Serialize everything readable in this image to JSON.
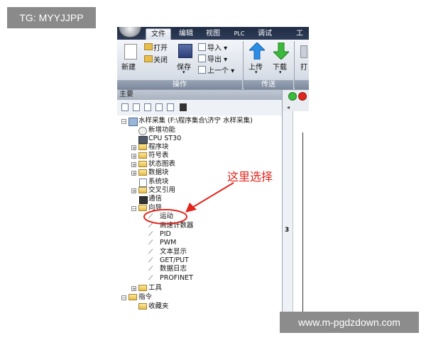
{
  "overlay": {
    "tag": "TG: MYYJJPP",
    "watermark": "www.m-pgdzdown.com",
    "annotation": "这里选择"
  },
  "ribbon": {
    "tabs": [
      "文件",
      "编辑",
      "视图",
      "PLC",
      "调试",
      "工"
    ],
    "groups": {
      "operate": {
        "label": "操作",
        "new": "新建",
        "open": "打开",
        "close": "关闭",
        "save": "保存",
        "import": "导入",
        "export": "导出",
        "previous": "上一个"
      },
      "transfer": {
        "label": "传送",
        "upload": "上传",
        "download": "下载",
        "partial": "打"
      }
    }
  },
  "panel": {
    "title": "主要"
  },
  "tree": {
    "project": "水样采集 (F:\\程序集合\\济宁 水样采集)",
    "new_features": "新增功能",
    "cpu": "CPU ST30",
    "program_block": "程序块",
    "symbol_table": "符号表",
    "status_chart": "状态图表",
    "data_block": "数据块",
    "system_block": "系统块",
    "cross_ref": "交叉引用",
    "comm": "通信",
    "wizard": "向导",
    "wizards": [
      "运动",
      "高速计数器",
      "PID",
      "PWM",
      "文本显示",
      "GET/PUT",
      "数据日志",
      "PROFINET"
    ],
    "tools": "工具",
    "instructions": "指令",
    "favorites": "收藏夹"
  },
  "editor": {
    "line_number": "3"
  },
  "colors": {
    "accent_red": "#e0261d",
    "ribbon_dark": "#1f2c44",
    "folder": "#e7bd4b"
  }
}
